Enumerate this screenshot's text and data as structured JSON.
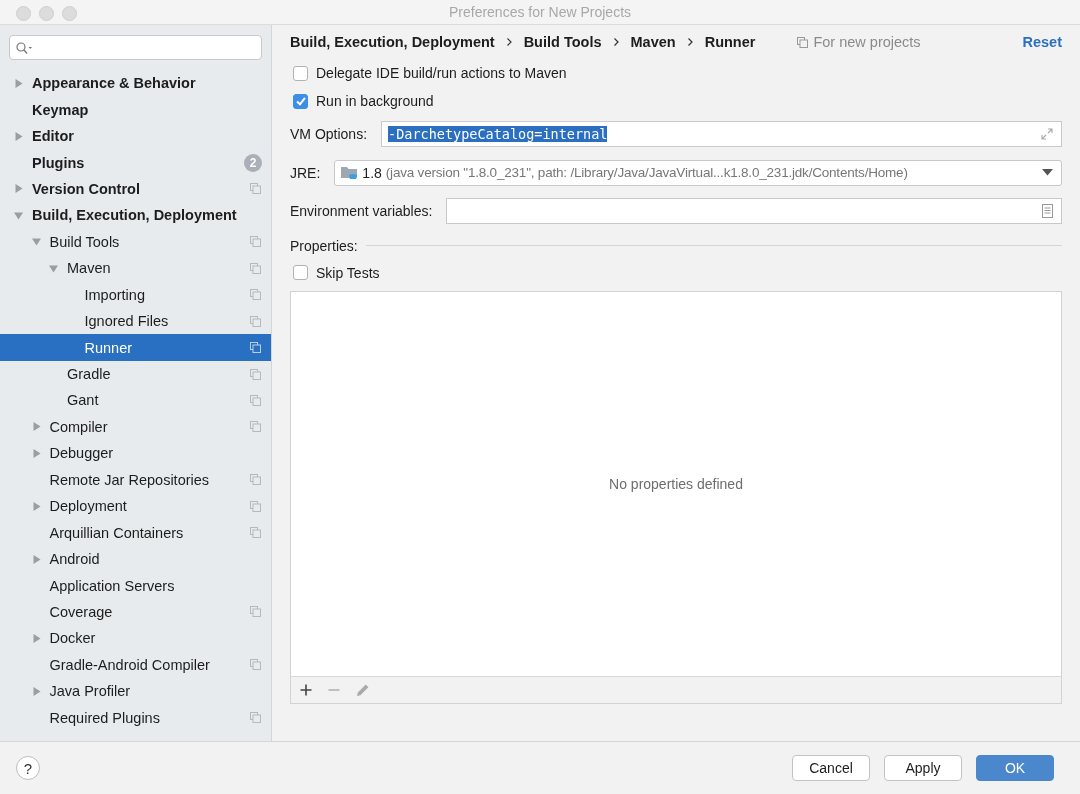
{
  "window": {
    "title": "Preferences for New Projects"
  },
  "sidebar": {
    "items": [
      {
        "label": "Appearance & Behavior",
        "expanded": false,
        "selected": false,
        "project_icon": false
      },
      {
        "label": "Keymap",
        "selected": false,
        "project_icon": false
      },
      {
        "label": "Editor",
        "expanded": false,
        "selected": false,
        "project_icon": false
      },
      {
        "label": "Plugins",
        "selected": false,
        "project_icon": false,
        "badge": "2"
      },
      {
        "label": "Version Control",
        "expanded": false,
        "selected": false,
        "project_icon": true
      },
      {
        "label": "Build, Execution, Deployment",
        "expanded": true,
        "selected": false,
        "project_icon": false,
        "children": [
          {
            "label": "Build Tools",
            "expanded": true,
            "selected": false,
            "project_icon": true,
            "children": [
              {
                "label": "Maven",
                "expanded": true,
                "selected": false,
                "project_icon": true,
                "children": [
                  {
                    "label": "Importing",
                    "selected": false,
                    "project_icon": true
                  },
                  {
                    "label": "Ignored Files",
                    "selected": false,
                    "project_icon": true
                  },
                  {
                    "label": "Runner",
                    "selected": true,
                    "project_icon": true
                  }
                ]
              },
              {
                "label": "Gradle",
                "selected": false,
                "project_icon": true
              },
              {
                "label": "Gant",
                "selected": false,
                "project_icon": true
              }
            ]
          },
          {
            "label": "Compiler",
            "expanded": false,
            "selected": false,
            "project_icon": true
          },
          {
            "label": "Debugger",
            "expanded": false,
            "selected": false,
            "project_icon": false
          },
          {
            "label": "Remote Jar Repositories",
            "selected": false,
            "project_icon": true
          },
          {
            "label": "Deployment",
            "expanded": false,
            "selected": false,
            "project_icon": true
          },
          {
            "label": "Arquillian Containers",
            "selected": false,
            "project_icon": true
          },
          {
            "label": "Android",
            "expanded": false,
            "selected": false,
            "project_icon": false
          },
          {
            "label": "Application Servers",
            "selected": false,
            "project_icon": false
          },
          {
            "label": "Coverage",
            "selected": false,
            "project_icon": true
          },
          {
            "label": "Docker",
            "expanded": false,
            "selected": false,
            "project_icon": false
          },
          {
            "label": "Gradle-Android Compiler",
            "selected": false,
            "project_icon": true
          },
          {
            "label": "Java Profiler",
            "expanded": false,
            "selected": false,
            "project_icon": false
          },
          {
            "label": "Required Plugins",
            "selected": false,
            "project_icon": true
          }
        ]
      }
    ]
  },
  "breadcrumb": [
    "Build, Execution, Deployment",
    "Build Tools",
    "Maven",
    "Runner"
  ],
  "scope_note": "For new projects",
  "reset": "Reset",
  "options": [
    {
      "label": "Delegate IDE build/run actions to Maven",
      "checked": false
    },
    {
      "label": "Run in background",
      "checked": true
    }
  ],
  "vm_options": {
    "label": "VM Options:",
    "value": "-DarchetypeCatalog=internal",
    "text_selected": true
  },
  "jre": {
    "label": "JRE:",
    "version": "1.8",
    "detail": "(java version \"1.8.0_231\", path: /Library/Java/JavaVirtual...k1.8.0_231.jdk/Contents/Home)"
  },
  "environment": {
    "label": "Environment variables:"
  },
  "properties": {
    "label": "Properties:",
    "skip_tests": {
      "label": "Skip Tests",
      "checked": false
    },
    "empty_text": "No properties defined"
  },
  "help": "?",
  "buttons": [
    {
      "label": "Cancel",
      "kind": "default"
    },
    {
      "label": "Apply",
      "kind": "default"
    },
    {
      "label": "OK",
      "kind": "primary"
    }
  ]
}
